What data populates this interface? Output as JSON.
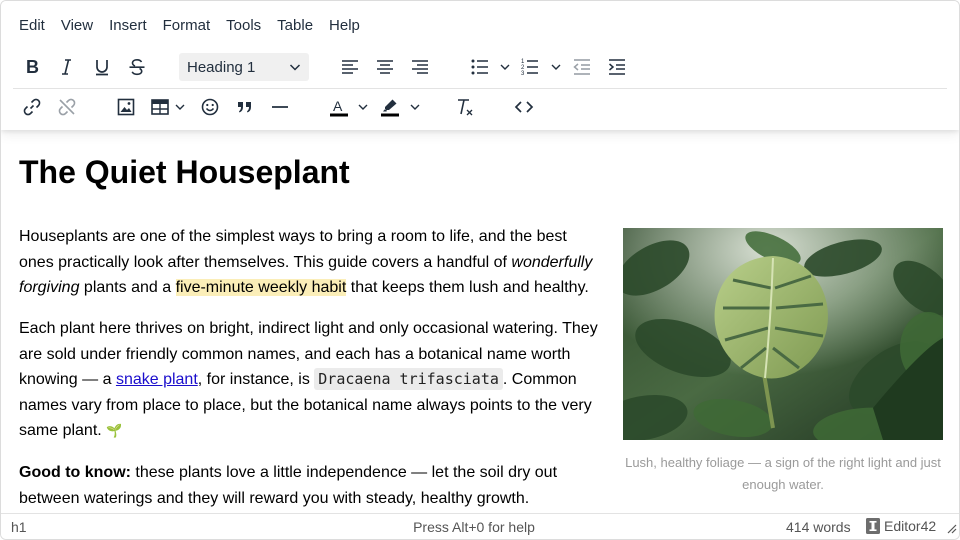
{
  "menubar": {
    "items": [
      "Edit",
      "View",
      "Insert",
      "Format",
      "Tools",
      "Table",
      "Help"
    ]
  },
  "toolbar": {
    "block_format": "Heading 1",
    "row1_icons": [
      "bold-icon",
      "italic-icon",
      "underline-icon",
      "strikethrough-icon",
      "align-left-icon",
      "align-center-icon",
      "align-right-icon",
      "bullet-list-icon",
      "numbered-list-icon",
      "outdent-icon",
      "indent-icon"
    ],
    "row2_icons": [
      "link-icon",
      "unlink-icon",
      "image-icon",
      "table-icon",
      "emoji-icon",
      "blockquote-icon",
      "horizontal-rule-icon",
      "text-color-icon",
      "highlight-color-icon",
      "clear-formatting-icon",
      "source-code-icon"
    ],
    "text_color": "#000000",
    "highlight_color": "#000000"
  },
  "document": {
    "title": "The Quiet Houseplant",
    "p1": {
      "t1": "Houseplants are one of the simplest ways to bring a room to life, and the best ones practically look after themselves. This guide covers a handful of ",
      "em": "wonderfully forgiving",
      "t2": " plants and a ",
      "highlight": "five-minute weekly habit",
      "t3": " that keeps them lush and healthy."
    },
    "p2": {
      "t1": "Each plant here thrives on bright, indirect light and only occasional watering. They are sold under friendly common names, and each has a botanical name worth knowing — a ",
      "link": "snake plant",
      "t2": ", for instance, is ",
      "code": "Dracaena trifasciata",
      "t3": ". Common names vary from place to place, but the botanical name always points to the very same plant. ",
      "mark": "🌱"
    },
    "p3": {
      "strong": "Good to know:",
      "t1": " these plants love a little independence — let the soil dry out between waterings and they will reward you with steady, healthy growth."
    },
    "figure": {
      "caption": "Lush, healthy foliage — a sign of the right light and just enough water."
    }
  },
  "colors": {
    "highlight_bg": "#fbeeb8",
    "link": "#1a0dcc",
    "code_bg": "#ebebeb"
  },
  "statusbar": {
    "path": "h1",
    "help": "Press Alt+0 for help",
    "words": "414 words",
    "brand": "Editor42"
  }
}
